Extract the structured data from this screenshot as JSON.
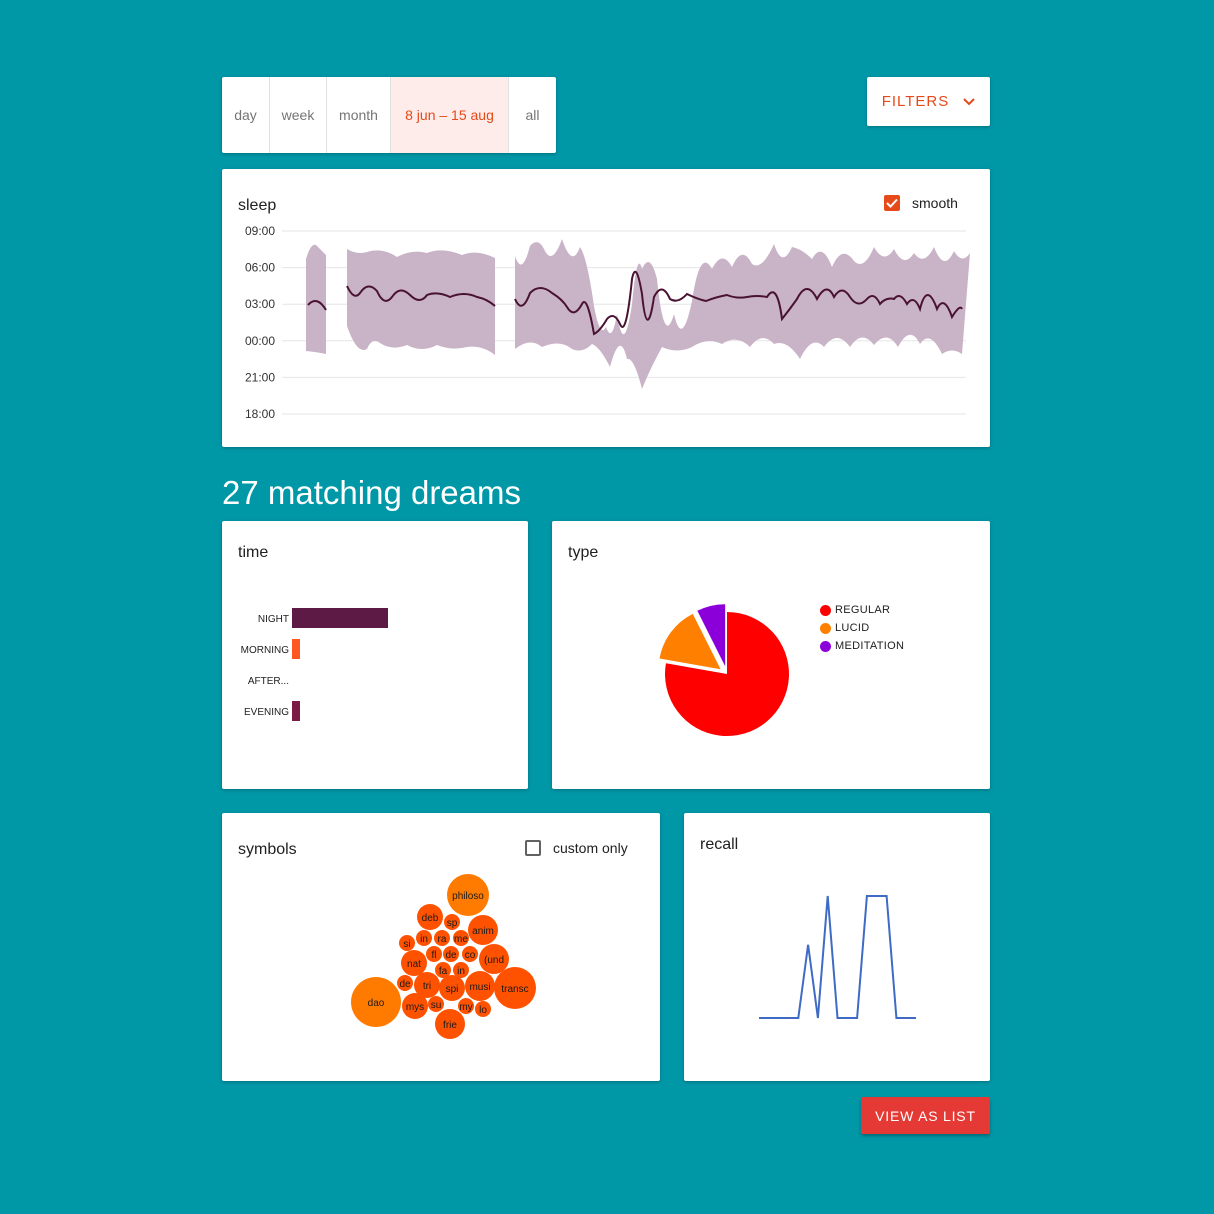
{
  "range_tabs": [
    {
      "label": "day",
      "active": false
    },
    {
      "label": "week",
      "active": false
    },
    {
      "label": "month",
      "active": false
    },
    {
      "label": "8 jun – 15 aug",
      "active": true
    },
    {
      "label": "all",
      "active": false
    }
  ],
  "filters": {
    "label": "FILTERS",
    "icon": "chevron-down-icon"
  },
  "sleep": {
    "title": "sleep",
    "smooth_label": "smooth",
    "smooth_checked": true,
    "y_ticks": [
      "09:00",
      "06:00",
      "03:00",
      "00:00",
      "21:00",
      "18:00"
    ],
    "colors": {
      "band": "#c9b3c6",
      "line": "#4a1231"
    }
  },
  "matching": {
    "count": "27",
    "label": "matching dreams"
  },
  "time": {
    "title": "time",
    "chart_data": {
      "type": "bar",
      "orientation": "horizontal",
      "categories": [
        "NIGHT",
        "MORNING",
        "AFTER...",
        "EVENING"
      ],
      "values": [
        24,
        2,
        0,
        2
      ],
      "colors": [
        "#5c1a45",
        "#ff5722",
        "#5c1a45",
        "#7a1a45"
      ]
    }
  },
  "type": {
    "title": "type",
    "chart_data": {
      "type": "pie",
      "labels": [
        "REGULAR",
        "LUCID",
        "MEDITATION"
      ],
      "values": [
        21,
        4,
        2
      ],
      "colors": [
        "#ff0000",
        "#ff8000",
        "#8b00d9"
      ]
    }
  },
  "symbols": {
    "title": "symbols",
    "custom_only_label": "custom only",
    "custom_only_checked": false,
    "bubbles": [
      {
        "label": "philoso",
        "size": 5,
        "color": "#ff7b00"
      },
      {
        "label": "deb",
        "size": 2,
        "color": "#ff5200"
      },
      {
        "label": "sp",
        "size": 1,
        "color": "#ff5200"
      },
      {
        "label": "anim",
        "size": 3,
        "color": "#ff5200"
      },
      {
        "label": "si",
        "size": 1,
        "color": "#ff5200"
      },
      {
        "label": "in",
        "size": 1,
        "color": "#ff5200"
      },
      {
        "label": "ra",
        "size": 1,
        "color": "#ff5200"
      },
      {
        "label": "me",
        "size": 1,
        "color": "#ff5200"
      },
      {
        "label": "fl",
        "size": 1,
        "color": "#ff5200"
      },
      {
        "label": "de",
        "size": 1,
        "color": "#ff5200"
      },
      {
        "label": "co",
        "size": 1,
        "color": "#ff5200"
      },
      {
        "label": "(und",
        "size": 3,
        "color": "#ff5200"
      },
      {
        "label": "nat",
        "size": 2,
        "color": "#ff5200"
      },
      {
        "label": "fa",
        "size": 1,
        "color": "#ff5200"
      },
      {
        "label": "in",
        "size": 1,
        "color": "#ff5200"
      },
      {
        "label": "de",
        "size": 1,
        "color": "#ff5200"
      },
      {
        "label": "tri",
        "size": 2,
        "color": "#ff5200"
      },
      {
        "label": "spi",
        "size": 2,
        "color": "#ff5200"
      },
      {
        "label": "musi",
        "size": 3,
        "color": "#ff5200"
      },
      {
        "label": "transc",
        "size": 5,
        "color": "#ff5200"
      },
      {
        "label": "dao",
        "size": 7,
        "color": "#ff7b00"
      },
      {
        "label": "mys",
        "size": 2,
        "color": "#ff5200"
      },
      {
        "label": "su",
        "size": 1,
        "color": "#ff5200"
      },
      {
        "label": "my",
        "size": 1,
        "color": "#ff5200"
      },
      {
        "label": "lo",
        "size": 1,
        "color": "#ff5200"
      },
      {
        "label": "frie",
        "size": 3,
        "color": "#ff5200"
      }
    ]
  },
  "recall": {
    "title": "recall",
    "chart_data": {
      "type": "line",
      "values": [
        0,
        0,
        0,
        0,
        0,
        0.6,
        0,
        1,
        0,
        0,
        0,
        1,
        1,
        1,
        0,
        0,
        0
      ],
      "color": "#3f6bc4"
    }
  },
  "view_list": {
    "label": "VIEW AS LIST"
  }
}
